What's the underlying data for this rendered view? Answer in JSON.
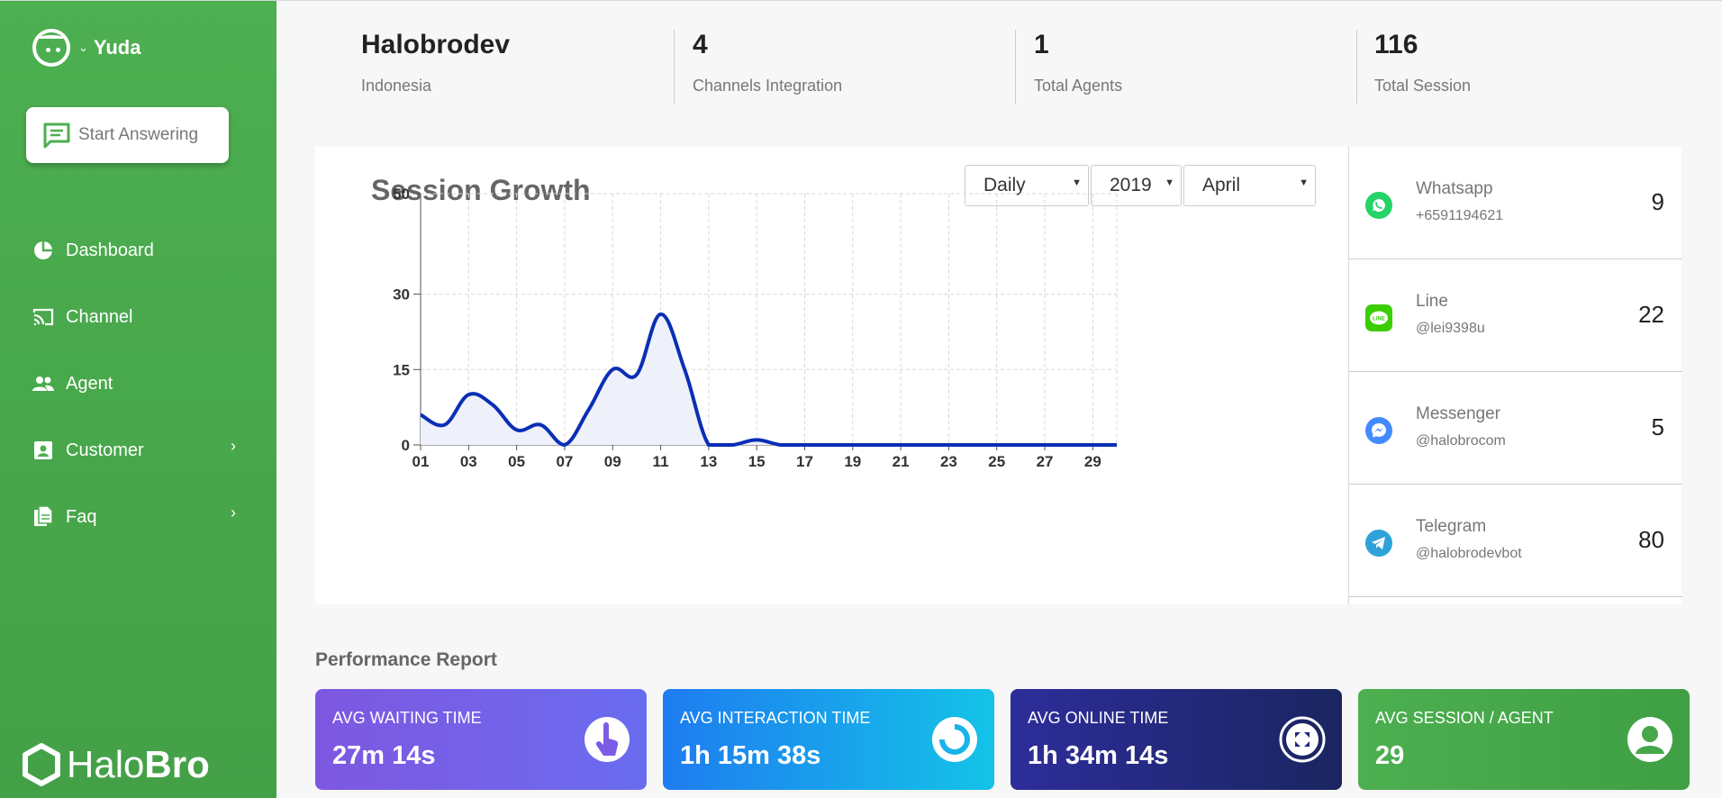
{
  "sidebar": {
    "user_name": "Yuda",
    "start_button": "Start Answering",
    "items": [
      {
        "label": "Dashboard",
        "icon": "pie-icon"
      },
      {
        "label": "Channel",
        "icon": "cast-icon"
      },
      {
        "label": "Agent",
        "icon": "people-icon"
      },
      {
        "label": "Customer",
        "icon": "contact-icon",
        "chevron": true
      },
      {
        "label": "Faq",
        "icon": "document-icon",
        "chevron": true
      }
    ],
    "logo_light": "Halo",
    "logo_bold": "Bro"
  },
  "stats": [
    {
      "value": "Halobrodev",
      "label": "Indonesia"
    },
    {
      "value": "4",
      "label": "Channels Integration"
    },
    {
      "value": "1",
      "label": "Total Agents"
    },
    {
      "value": "116",
      "label": "Total Session"
    }
  ],
  "chart": {
    "title": "Session Growth",
    "filters": {
      "period": "Daily",
      "year": "2019",
      "month": "April"
    }
  },
  "chart_data": {
    "type": "area",
    "title": "Session Growth",
    "x": [
      "01",
      "02",
      "03",
      "04",
      "05",
      "06",
      "07",
      "08",
      "09",
      "10",
      "11",
      "12",
      "13",
      "14",
      "15",
      "16",
      "17",
      "18",
      "19",
      "20",
      "21",
      "22",
      "23",
      "24",
      "25",
      "26",
      "27",
      "28",
      "29",
      "30"
    ],
    "x_tick_labels": [
      "01",
      "03",
      "05",
      "07",
      "09",
      "11",
      "13",
      "15",
      "17",
      "19",
      "21",
      "23",
      "25",
      "27",
      "29"
    ],
    "y_tick_labels": [
      "0",
      "15",
      "30",
      "50"
    ],
    "series": [
      {
        "values": [
          6,
          4,
          10,
          8,
          3,
          4,
          0,
          7,
          15,
          14,
          26,
          15,
          0,
          0,
          1,
          0,
          0,
          0,
          0,
          0,
          0,
          0,
          0,
          0,
          0,
          0,
          0,
          0,
          0,
          0
        ]
      }
    ],
    "ylim": [
      0,
      50
    ],
    "grid": true,
    "colors": {
      "line": "#0a2eb5",
      "fill": "#eef0fa"
    }
  },
  "channels": [
    {
      "name": "Whatsapp",
      "account": "+6591194621",
      "count": "9",
      "icon": "whatsapp-icon",
      "color": "#25d366"
    },
    {
      "name": "Line",
      "account": "@lei9398u",
      "count": "22",
      "icon": "line-icon",
      "color": "#3acd01"
    },
    {
      "name": "Messenger",
      "account": "@halobrocom",
      "count": "5",
      "icon": "messenger-icon",
      "color": "#448aff"
    },
    {
      "name": "Telegram",
      "account": "@halobrodevbot",
      "count": "80",
      "icon": "telegram-icon",
      "color": "#2fa3d9"
    }
  ],
  "performance": {
    "title": "Performance Report",
    "cards": [
      {
        "title": "AVG WAITING TIME",
        "value": "27m 14s",
        "icon": "hand-pointer-icon"
      },
      {
        "title": "AVG INTERACTION TIME",
        "value": "1h 15m 38s",
        "icon": "ring-icon"
      },
      {
        "title": "AVG ONLINE TIME",
        "value": "1h 34m 14s",
        "icon": "arrows-icon"
      },
      {
        "title": "AVG SESSION / AGENT",
        "value": "29",
        "icon": "user-icon"
      }
    ]
  }
}
